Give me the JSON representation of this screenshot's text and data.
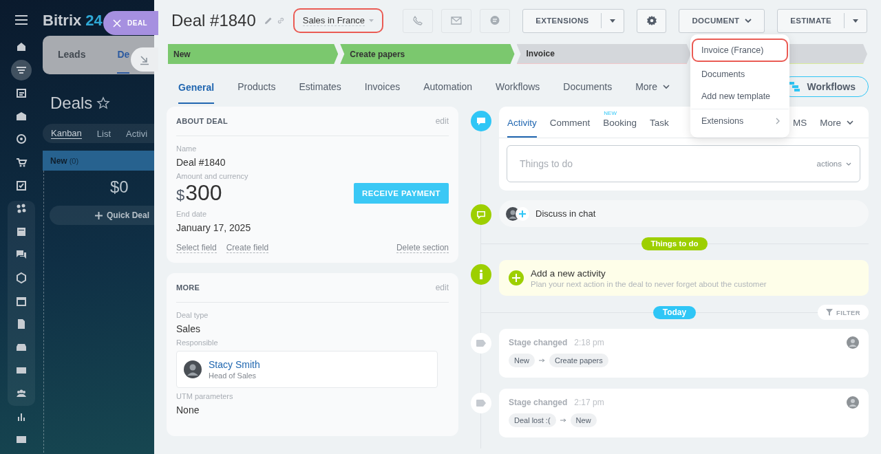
{
  "background": {
    "logo": {
      "name": "Bitrix",
      "number": "24"
    },
    "crm_tabs": [
      {
        "label": "Leads",
        "selected": false
      },
      {
        "label": "De",
        "selected": true
      }
    ],
    "title": "Deals",
    "view_tabs": [
      {
        "label": "Kanban",
        "selected": true
      },
      {
        "label": "List",
        "selected": false
      },
      {
        "label": "Activi",
        "selected": false
      }
    ],
    "kanban_column": {
      "name": "New",
      "count": "(0)",
      "total": "$0",
      "quick_add": "Quick Deal"
    }
  },
  "slider_tab": {
    "label": "DEAL"
  },
  "deal": {
    "title": "Deal #1840",
    "pipeline": "Sales in France",
    "pipeline_highlighted": true
  },
  "header_buttons": [
    {
      "label": "EXTENSIONS",
      "kind": "split"
    },
    {
      "label": "DOCUMENT",
      "kind": "dropdown"
    },
    {
      "label": "ESTIMATE",
      "kind": "split"
    }
  ],
  "stages": [
    {
      "label": "New",
      "reached": true
    },
    {
      "label": "Create papers",
      "reached": true
    },
    {
      "label": "Invoice",
      "reached": false
    }
  ],
  "tabs": [
    {
      "label": "General",
      "selected": true
    },
    {
      "label": "Products",
      "selected": false
    },
    {
      "label": "Estimates",
      "selected": false
    },
    {
      "label": "Invoices",
      "selected": false
    },
    {
      "label": "Automation",
      "selected": false
    },
    {
      "label": "Workflows",
      "selected": false
    },
    {
      "label": "Documents",
      "selected": false
    },
    {
      "label": "More",
      "selected": false
    }
  ],
  "workflows_button": "Workflows",
  "document_menu": [
    {
      "label": "Invoice (France)",
      "kind": "item",
      "highlighted": true
    },
    {
      "label": "Documents",
      "kind": "item",
      "highlighted": false
    },
    {
      "label": "Add new template",
      "kind": "item",
      "highlighted": false
    },
    {
      "label": "Extensions",
      "kind": "submenu",
      "highlighted": false
    }
  ],
  "about_card": {
    "title": "ABOUT DEAL",
    "edit": "edit",
    "name_label": "Name",
    "name": "Deal #1840",
    "amount_label": "Amount and currency",
    "currency": "$",
    "amount": "300",
    "pay_button": "RECEIVE PAYMENT",
    "date_label": "End date",
    "date": "January 17, 2025",
    "links": [
      "Select field",
      "Create field"
    ],
    "delete_link": "Delete section"
  },
  "more_card": {
    "title": "MORE",
    "edit": "edit",
    "type_label": "Deal type",
    "type": "Sales",
    "responsible_label": "Responsible",
    "person_name": "Stacy Smith",
    "person_position": "Head of Sales",
    "utm_label": "UTM parameters",
    "utm": "None"
  },
  "activity_editor": {
    "tabs": [
      {
        "label": "Activity",
        "selected": true
      },
      {
        "label": "Comment",
        "selected": false
      },
      {
        "label": "Booking",
        "selected": false,
        "badge": "NEW"
      },
      {
        "label": "Task",
        "selected": false
      },
      {
        "label": "MS",
        "selected": false
      },
      {
        "label": "More",
        "selected": false
      }
    ],
    "placeholder": "Things to do",
    "actions": "actions"
  },
  "chat": {
    "label": "Discuss in chat"
  },
  "todo_divider": "Things to do",
  "new_activity": {
    "title": "Add a new activity",
    "hint": "Plan your next action in the deal to never forget about the customer"
  },
  "today_divider": "Today",
  "filter": "FILTER",
  "history": [
    {
      "title": "Stage changed",
      "time": "2:18 pm",
      "from": "New",
      "to": "Create papers"
    },
    {
      "title": "Stage changed",
      "time": "2:17 pm",
      "from": "Deal lost :(",
      "to": "New"
    }
  ]
}
